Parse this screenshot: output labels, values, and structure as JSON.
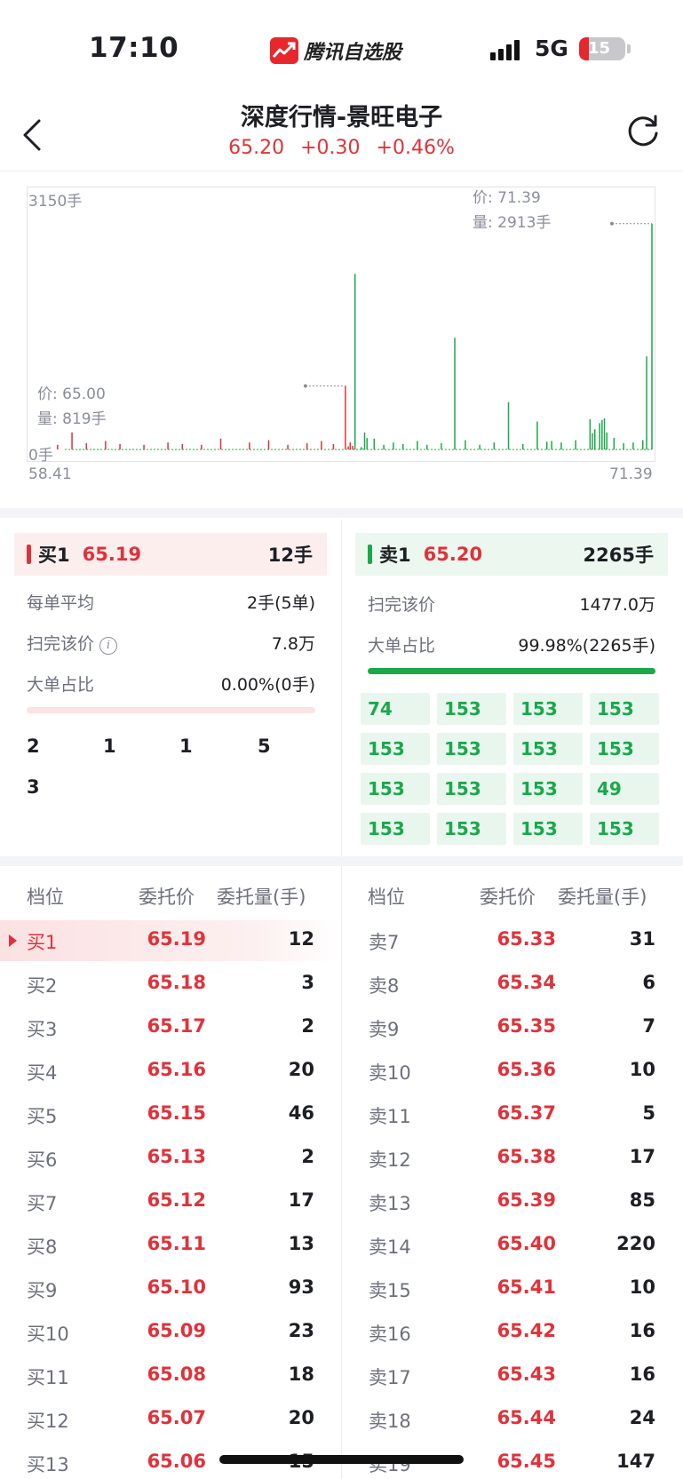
{
  "status_bar": {
    "time": "17:10",
    "app_name": "腾讯自选股",
    "network": "5G",
    "battery": "15"
  },
  "header": {
    "title": "深度行情-景旺电子",
    "price": "65.20",
    "change": "+0.30",
    "change_pct": "+0.46%"
  },
  "chart_data": {
    "type": "bar",
    "y_max_label": "3150手",
    "y_min_label": "0手",
    "x_min_label": "58.41",
    "x_max_label": "71.39",
    "ylim": [
      0,
      3150
    ],
    "xlim": [
      58.41,
      71.39
    ],
    "grid": false,
    "tooltip_left": {
      "price": "价: 65.00",
      "volume": "量: 819手"
    },
    "tooltip_right": {
      "price": "价: 71.39",
      "volume": "量: 2913手"
    },
    "buy_color": "#e0323a",
    "sell_color": "#1aa84a",
    "buy_bars": [
      {
        "x": 59.0,
        "y": 60
      },
      {
        "x": 59.3,
        "y": 220
      },
      {
        "x": 59.6,
        "y": 80
      },
      {
        "x": 60.0,
        "y": 110
      },
      {
        "x": 60.3,
        "y": 70
      },
      {
        "x": 60.8,
        "y": 60
      },
      {
        "x": 61.3,
        "y": 90
      },
      {
        "x": 61.6,
        "y": 70
      },
      {
        "x": 62.0,
        "y": 60
      },
      {
        "x": 62.4,
        "y": 140
      },
      {
        "x": 63.0,
        "y": 90
      },
      {
        "x": 63.4,
        "y": 120
      },
      {
        "x": 63.8,
        "y": 60
      },
      {
        "x": 64.2,
        "y": 80
      },
      {
        "x": 64.5,
        "y": 110
      },
      {
        "x": 64.75,
        "y": 70
      },
      {
        "x": 65.0,
        "y": 819
      },
      {
        "x": 65.06,
        "y": 40
      },
      {
        "x": 65.1,
        "y": 93
      },
      {
        "x": 65.15,
        "y": 46
      },
      {
        "x": 65.19,
        "y": 12
      }
    ],
    "sell_bars": [
      {
        "x": 65.2,
        "y": 2265
      },
      {
        "x": 65.33,
        "y": 31
      },
      {
        "x": 65.36,
        "y": 10
      },
      {
        "x": 65.4,
        "y": 220
      },
      {
        "x": 65.45,
        "y": 147
      },
      {
        "x": 65.6,
        "y": 140
      },
      {
        "x": 65.8,
        "y": 60
      },
      {
        "x": 66.0,
        "y": 90
      },
      {
        "x": 66.2,
        "y": 70
      },
      {
        "x": 66.5,
        "y": 110
      },
      {
        "x": 66.7,
        "y": 60
      },
      {
        "x": 67.0,
        "y": 80
      },
      {
        "x": 67.28,
        "y": 1440
      },
      {
        "x": 67.5,
        "y": 120
      },
      {
        "x": 67.8,
        "y": 60
      },
      {
        "x": 68.1,
        "y": 90
      },
      {
        "x": 68.4,
        "y": 610
      },
      {
        "x": 68.7,
        "y": 70
      },
      {
        "x": 69.0,
        "y": 360
      },
      {
        "x": 69.2,
        "y": 100
      },
      {
        "x": 69.3,
        "y": 110
      },
      {
        "x": 69.5,
        "y": 90
      },
      {
        "x": 69.8,
        "y": 120
      },
      {
        "x": 70.1,
        "y": 390
      },
      {
        "x": 70.15,
        "y": 210
      },
      {
        "x": 70.2,
        "y": 260
      },
      {
        "x": 70.3,
        "y": 340
      },
      {
        "x": 70.35,
        "y": 380
      },
      {
        "x": 70.4,
        "y": 400
      },
      {
        "x": 70.45,
        "y": 220
      },
      {
        "x": 70.6,
        "y": 150
      },
      {
        "x": 70.8,
        "y": 80
      },
      {
        "x": 71.0,
        "y": 90
      },
      {
        "x": 71.2,
        "y": 120
      },
      {
        "x": 71.28,
        "y": 1200
      },
      {
        "x": 71.39,
        "y": 2913
      }
    ]
  },
  "buy_panel": {
    "label": "买1",
    "price": "65.19",
    "qty": "12手",
    "avg_label": "每单平均",
    "avg_value": "2手(5单)",
    "sweep_label": "扫完该价",
    "sweep_value": "7.8万",
    "large_label": "大单占比",
    "large_value": "0.00%(0手)",
    "large_ratio": 0.0,
    "orders": [
      "2",
      "1",
      "1",
      "5",
      "3"
    ]
  },
  "sell_panel": {
    "label": "卖1",
    "price": "65.20",
    "qty": "2265手",
    "sweep_label": "扫完该价",
    "sweep_value": "1477.0万",
    "large_label": "大单占比",
    "large_value": "99.98%(2265手)",
    "large_ratio": 0.9998,
    "orders": [
      "74",
      "153",
      "153",
      "153",
      "153",
      "153",
      "153",
      "153",
      "153",
      "153",
      "153",
      "49",
      "153",
      "153",
      "153",
      "153"
    ]
  },
  "order_book": {
    "headers": {
      "level": "档位",
      "price": "委托价",
      "volume": "委托量(手)"
    },
    "buy": [
      {
        "level": "买1",
        "price": "65.19",
        "volume": "12"
      },
      {
        "level": "买2",
        "price": "65.18",
        "volume": "3"
      },
      {
        "level": "买3",
        "price": "65.17",
        "volume": "2"
      },
      {
        "level": "买4",
        "price": "65.16",
        "volume": "20"
      },
      {
        "level": "买5",
        "price": "65.15",
        "volume": "46"
      },
      {
        "level": "买6",
        "price": "65.13",
        "volume": "2"
      },
      {
        "level": "买7",
        "price": "65.12",
        "volume": "17"
      },
      {
        "level": "买8",
        "price": "65.11",
        "volume": "13"
      },
      {
        "level": "买9",
        "price": "65.10",
        "volume": "93"
      },
      {
        "level": "买10",
        "price": "65.09",
        "volume": "23"
      },
      {
        "level": "买11",
        "price": "65.08",
        "volume": "18"
      },
      {
        "level": "买12",
        "price": "65.07",
        "volume": "20"
      },
      {
        "level": "买13",
        "price": "65.06",
        "volume": "15"
      }
    ],
    "sell": [
      {
        "level": "卖7",
        "price": "65.33",
        "volume": "31"
      },
      {
        "level": "卖8",
        "price": "65.34",
        "volume": "6"
      },
      {
        "level": "卖9",
        "price": "65.35",
        "volume": "7"
      },
      {
        "level": "卖10",
        "price": "65.36",
        "volume": "10"
      },
      {
        "level": "卖11",
        "price": "65.37",
        "volume": "5"
      },
      {
        "level": "卖12",
        "price": "65.38",
        "volume": "17"
      },
      {
        "level": "卖13",
        "price": "65.39",
        "volume": "85"
      },
      {
        "level": "卖14",
        "price": "65.40",
        "volume": "220"
      },
      {
        "level": "卖15",
        "price": "65.41",
        "volume": "10"
      },
      {
        "level": "卖16",
        "price": "65.42",
        "volume": "16"
      },
      {
        "level": "卖17",
        "price": "65.43",
        "volume": "16"
      },
      {
        "level": "卖18",
        "price": "65.44",
        "volume": "24"
      },
      {
        "level": "卖19",
        "price": "65.45",
        "volume": "147"
      }
    ]
  }
}
